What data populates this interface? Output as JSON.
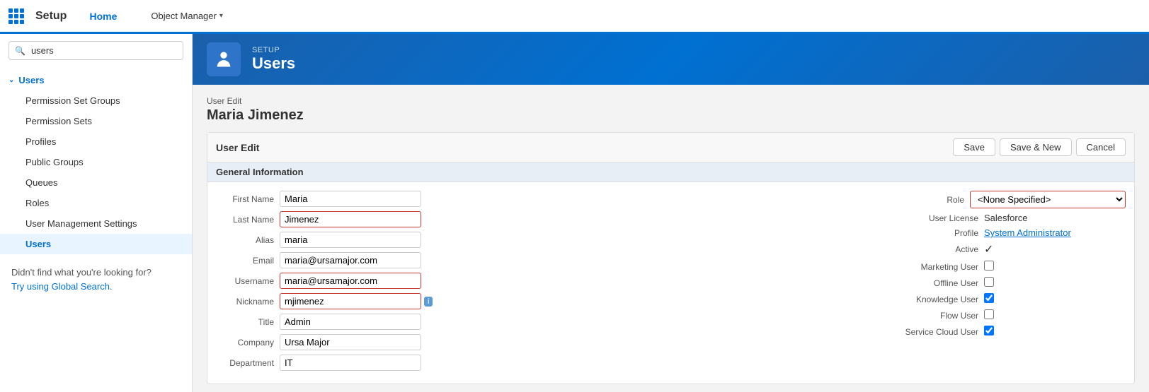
{
  "topNav": {
    "appGridLabel": "App Grid",
    "title": "Setup",
    "tabs": [
      {
        "id": "home",
        "label": "Home",
        "active": true
      },
      {
        "id": "object-manager",
        "label": "Object Manager",
        "active": false
      }
    ],
    "objectManagerChevron": "▾"
  },
  "sidebar": {
    "searchPlaceholder": "users",
    "searchValue": "users",
    "items": [
      {
        "id": "users-parent",
        "label": "Users",
        "type": "parent",
        "expanded": true
      },
      {
        "id": "permission-set-groups",
        "label": "Permission Set Groups",
        "type": "child"
      },
      {
        "id": "permission-sets",
        "label": "Permission Sets",
        "type": "child"
      },
      {
        "id": "profiles",
        "label": "Profiles",
        "type": "child"
      },
      {
        "id": "public-groups",
        "label": "Public Groups",
        "type": "child"
      },
      {
        "id": "queues",
        "label": "Queues",
        "type": "child"
      },
      {
        "id": "roles",
        "label": "Roles",
        "type": "child"
      },
      {
        "id": "user-management-settings",
        "label": "User Management Settings",
        "type": "child"
      },
      {
        "id": "users",
        "label": "Users",
        "type": "child",
        "active": true
      }
    ],
    "notFound": "Didn't find what you're looking for?",
    "tryGlobalSearch": "Try using Global Search."
  },
  "pageHeader": {
    "setupLabel": "SETUP",
    "title": "Users",
    "iconSymbol": "👤"
  },
  "form": {
    "breadcrumb": "User Edit",
    "userName": "Maria Jimenez",
    "panelTitle": "User Edit",
    "buttons": {
      "save": "Save",
      "saveNew": "Save & New",
      "cancel": "Cancel"
    },
    "sectionTitle": "General Information",
    "leftFields": [
      {
        "id": "first-name",
        "label": "First Name",
        "value": "Maria",
        "errorBorder": false
      },
      {
        "id": "last-name",
        "label": "Last Name",
        "value": "Jimenez",
        "errorBorder": true
      },
      {
        "id": "alias",
        "label": "Alias",
        "value": "maria",
        "errorBorder": false
      },
      {
        "id": "email",
        "label": "Email",
        "value": "maria@ursamajor.com",
        "errorBorder": false
      },
      {
        "id": "username",
        "label": "Username",
        "value": "maria@ursamajor.com",
        "errorBorder": true
      },
      {
        "id": "nickname",
        "label": "Nickname",
        "value": "mjimenez",
        "errorBorder": true,
        "hasInfo": true
      },
      {
        "id": "title",
        "label": "Title",
        "value": "Admin",
        "errorBorder": false
      },
      {
        "id": "company",
        "label": "Company",
        "value": "Ursa Major",
        "errorBorder": false
      },
      {
        "id": "department",
        "label": "Department",
        "value": "IT",
        "errorBorder": false
      }
    ],
    "rightFields": [
      {
        "id": "role",
        "label": "Role",
        "type": "select",
        "value": "<None Specified>",
        "options": [
          "<None Specified>"
        ]
      },
      {
        "id": "user-license",
        "label": "User License",
        "type": "text",
        "value": "Salesforce"
      },
      {
        "id": "profile",
        "label": "Profile",
        "type": "link",
        "value": "System Administrator"
      },
      {
        "id": "active",
        "label": "Active",
        "type": "checkbox",
        "checked": true
      },
      {
        "id": "marketing-user",
        "label": "Marketing User",
        "type": "checkbox",
        "checked": false
      },
      {
        "id": "offline-user",
        "label": "Offline User",
        "type": "checkbox",
        "checked": false
      },
      {
        "id": "knowledge-user",
        "label": "Knowledge User",
        "type": "checkbox",
        "checked": true
      },
      {
        "id": "flow-user",
        "label": "Flow User",
        "type": "checkbox",
        "checked": false
      },
      {
        "id": "service-cloud-user",
        "label": "Service Cloud User",
        "type": "checkbox",
        "checked": true
      }
    ]
  }
}
